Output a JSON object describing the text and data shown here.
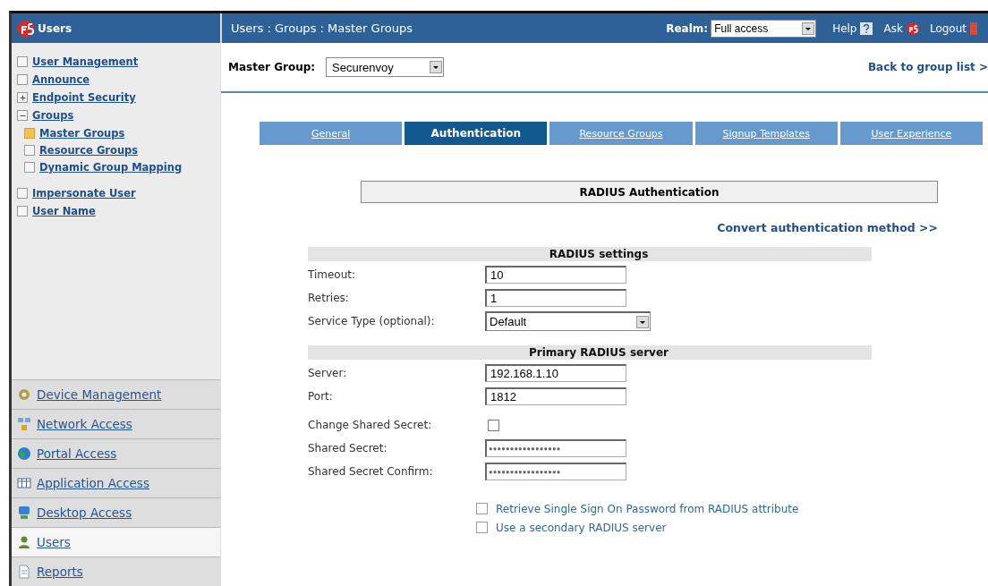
{
  "sidebar": {
    "title": "Users",
    "tree": [
      {
        "label": "User Management",
        "selected": false
      },
      {
        "label": "Announce",
        "selected": false
      },
      {
        "label": "Endpoint Security",
        "selected": false,
        "expanded": false
      },
      {
        "label": "Groups",
        "selected": false,
        "expanded": true,
        "children": [
          {
            "label": "Master Groups",
            "selected": true
          },
          {
            "label": "Resource Groups",
            "selected": false
          },
          {
            "label": "Dynamic Group Mapping",
            "selected": false
          }
        ]
      },
      {
        "label": "Impersonate User",
        "selected": false
      },
      {
        "label": "User Name",
        "selected": false
      }
    ],
    "nav": [
      {
        "label": "Device Management",
        "kind": "gear",
        "selected": false
      },
      {
        "label": "Network Access",
        "kind": "network",
        "selected": false
      },
      {
        "label": "Portal Access",
        "kind": "globe",
        "selected": false
      },
      {
        "label": "Application Access",
        "kind": "grid",
        "selected": false
      },
      {
        "label": "Desktop Access",
        "kind": "monitor",
        "selected": false
      },
      {
        "label": "Users",
        "kind": "user",
        "selected": true
      },
      {
        "label": "Reports",
        "kind": "document",
        "selected": false
      }
    ]
  },
  "header": {
    "breadcrumb": "Users : Groups : Master Groups",
    "realm_label": "Realm:",
    "realm_value": "Full access",
    "help": "Help",
    "ask": "Ask",
    "logout": "Logout"
  },
  "master_group": {
    "label": "Master Group:",
    "value": "Securenvoy"
  },
  "back_link": "Back to group list >",
  "tabs": [
    {
      "label": "General",
      "selected": false
    },
    {
      "label": "Authentication",
      "selected": true
    },
    {
      "label": "Resource Groups",
      "selected": false
    },
    {
      "label": "Signup Templates",
      "selected": false
    },
    {
      "label": "User Experience",
      "selected": false
    }
  ],
  "panel_title": "RADIUS Authentication",
  "convert_link": "Convert authentication method >>",
  "sections": [
    {
      "title": "RADIUS settings",
      "fields": [
        {
          "label": "Timeout:",
          "kind": "text",
          "value": "10"
        },
        {
          "label": "Retries:",
          "kind": "text",
          "value": "1"
        },
        {
          "label": "Service Type (optional):",
          "kind": "select",
          "value": "Default"
        }
      ]
    },
    {
      "title": "Primary RADIUS server",
      "fields": [
        {
          "label": "Server:",
          "kind": "text",
          "value": "192.168.1.10"
        },
        {
          "label": "Port:",
          "kind": "text",
          "value": "1812"
        },
        {
          "label": "Change Shared Secret:",
          "kind": "checkbox",
          "checked": false
        },
        {
          "label": "Shared Secret:",
          "kind": "password",
          "value": "●●●●●●●●●●●●●●●●●"
        },
        {
          "label": "Shared Secret Confirm:",
          "kind": "password",
          "value": "●●●●●●●●●●●●●●●●●"
        }
      ]
    }
  ],
  "options": [
    {
      "label": "Retrieve Single Sign On Password from RADIUS attribute",
      "checked": false
    },
    {
      "label": "Use a secondary RADIUS server",
      "checked": false
    }
  ]
}
